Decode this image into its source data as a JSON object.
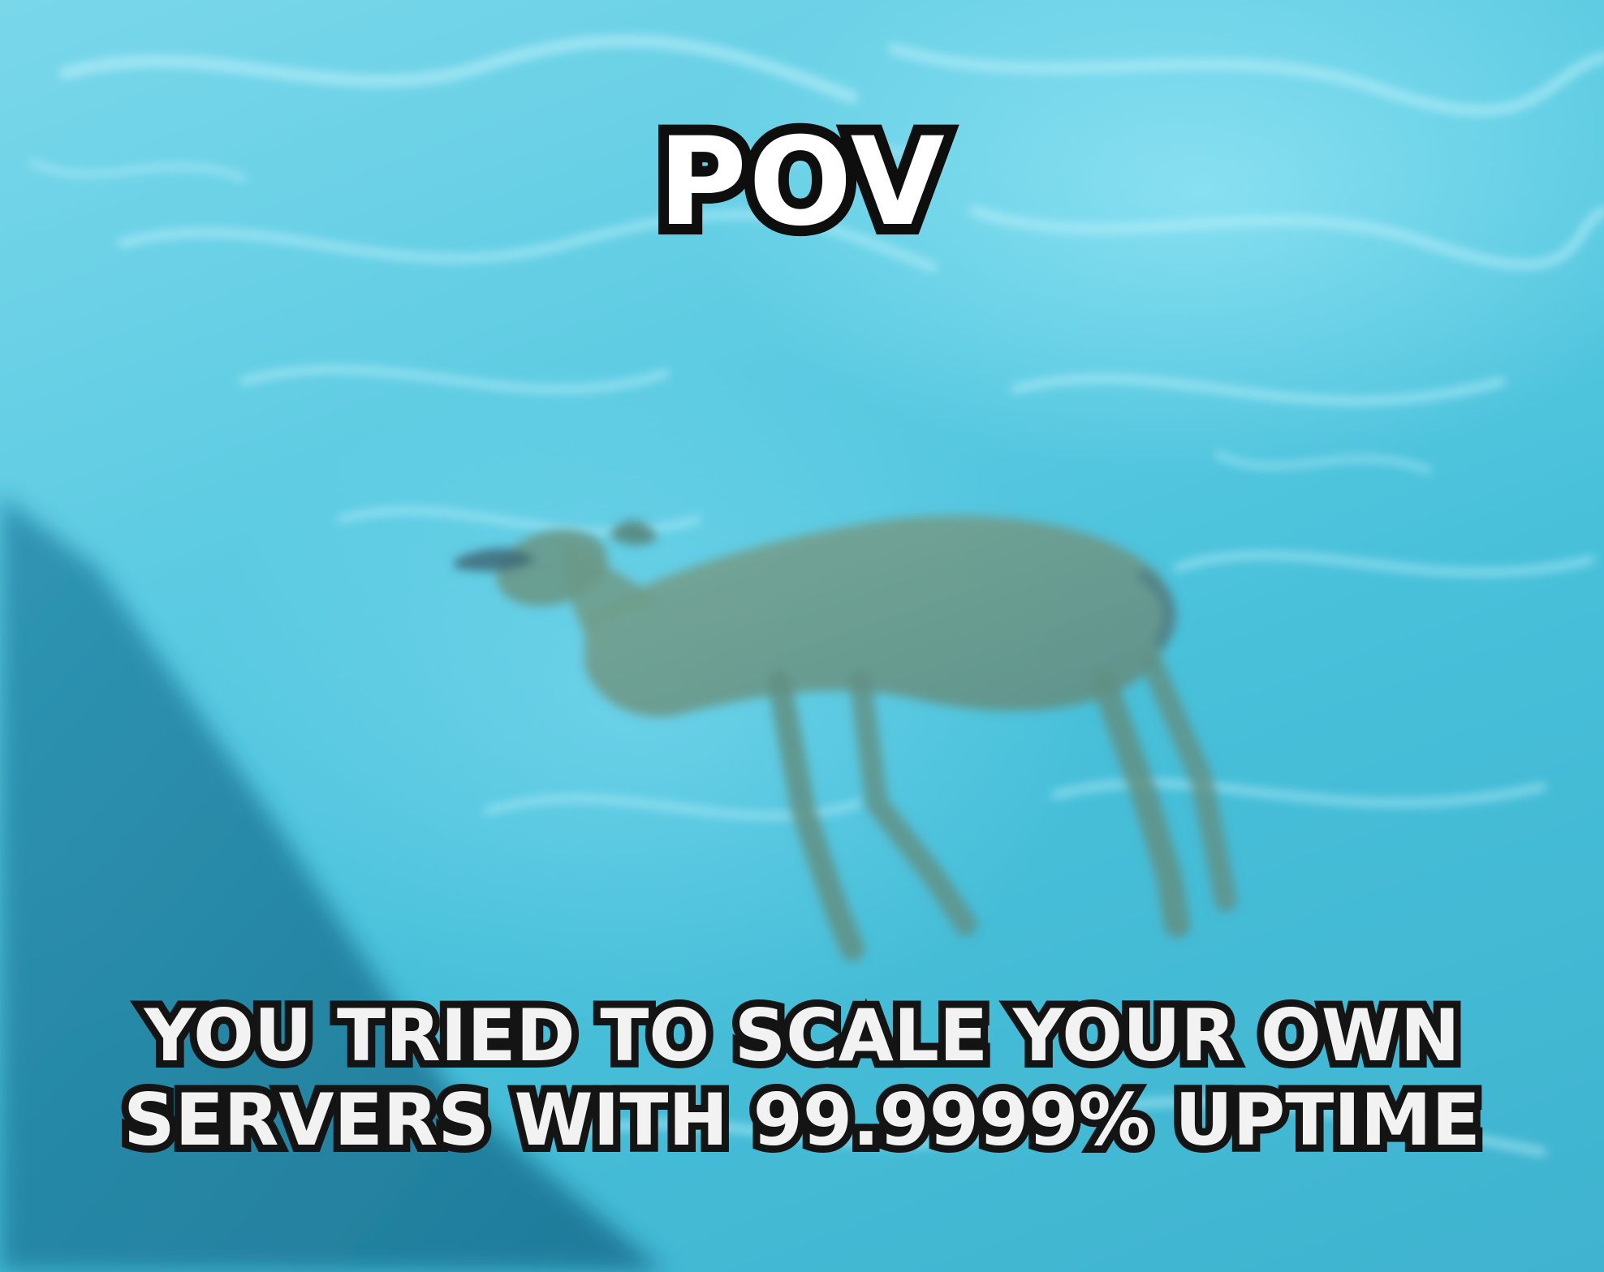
{
  "caption": {
    "top": "POV",
    "bottom_lines": [
      "YOU TRIED TO SCALE YOUR OWN",
      "SERVERS WITH 99.9999% UPTIME"
    ]
  },
  "colors": {
    "water": "#5ccbe2",
    "water_highlight": "#aaf0fc",
    "pool_wall_shadow": "#1f7f9e",
    "deer_body": "#6f9f8e",
    "caption_fill": "#ffffff",
    "caption_outline": "#111111"
  }
}
